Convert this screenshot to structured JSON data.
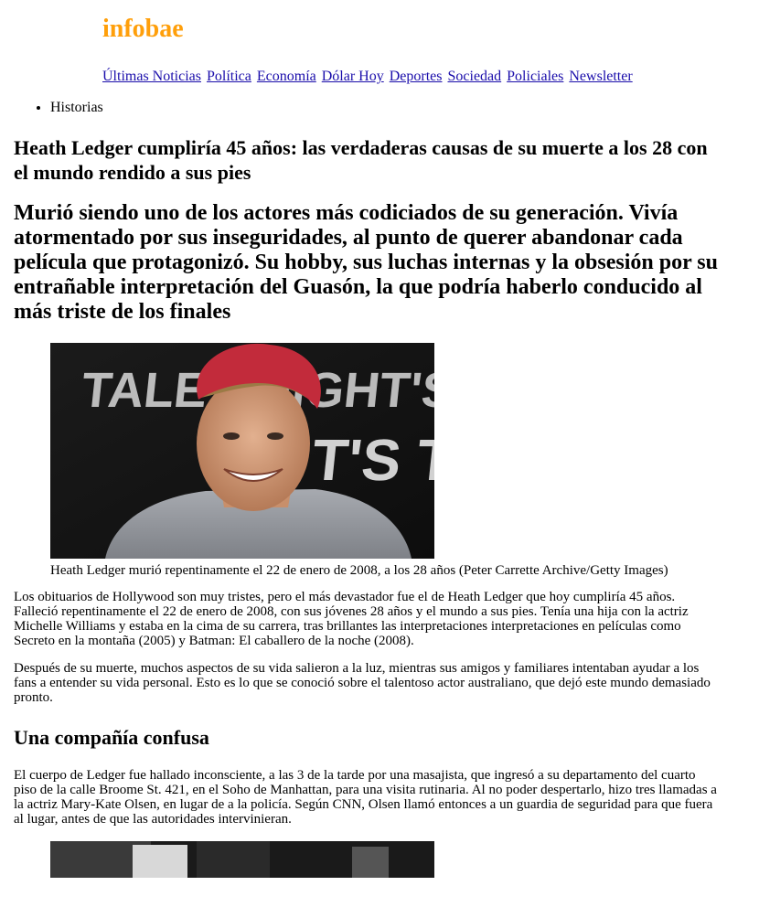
{
  "header": {
    "logo": "infobae",
    "nav": [
      "Últimas Noticias",
      "Política",
      "Economía",
      "Dólar Hoy",
      "Deportes",
      "Sociedad",
      "Policiales",
      "Newsletter"
    ],
    "sections": [
      "Historias"
    ]
  },
  "article": {
    "headline": "Heath Ledger cumpliría 45 años: las verdaderas causas de su muerte a los 28 con el mundo rendido a sus pies",
    "dek": "Murió siendo uno de los actores más codiciados de su generación. Vivía atormentado por sus inseguridades, al punto de querer abandonar cada película que protagonizó. Su hobby, sus luchas internas y la obsesión por su entrañable interpretación del Guasón, la que podría haberlo conducido al más triste de los finales",
    "photo1": {
      "caption": "Heath Ledger murió repentinamente el 22 de enero de 2008, a los 28 años (Peter Carrette Archive/Getty Images)",
      "backdrop_text_top": "TALE  KNIGHT'S TALE",
      "backdrop_text_bottom": "T'S TA"
    },
    "paragraphs": [
      "Los obituarios de Hollywood son muy tristes, pero el más devastador fue el de Heath Ledger que hoy cumpliría 45 años. Falleció repentinamente el 22 de enero de 2008, con sus jóvenes 28 años y el mundo a sus pies. Tenía una hija con la actriz Michelle Williams y estaba en la cima de su carrera, tras brillantes las interpretaciones interpretaciones en películas como Secreto en la montaña (2005) y Batman: El caballero de la noche (2008).",
      "Después de su muerte, muchos aspectos de su vida salieron a la luz, mientras sus amigos y familiares intentaban ayudar a los fans a entender su vida personal. Esto es lo que se conoció sobre el talentoso actor australiano, que dejó este mundo demasiado pronto."
    ],
    "subhead": "Una compañía confusa",
    "paragraphs2": [
      "El cuerpo de Ledger fue hallado inconsciente, a las 3 de la tarde por una masajista, que ingresó a su departamento del cuarto piso de la calle Broome St. 421, en el Soho de Manhattan, para una visita rutinaria. Al no poder despertarlo, hizo tres llamadas a la actriz Mary-Kate Olsen, en lugar de a la policía. Según CNN, Olsen llamó entonces a un guardia de seguridad para que fuera al lugar, antes de que las autoridades intervinieran."
    ]
  },
  "colors": {
    "logo": "#ff9f0a",
    "link": "#1a0dab"
  }
}
